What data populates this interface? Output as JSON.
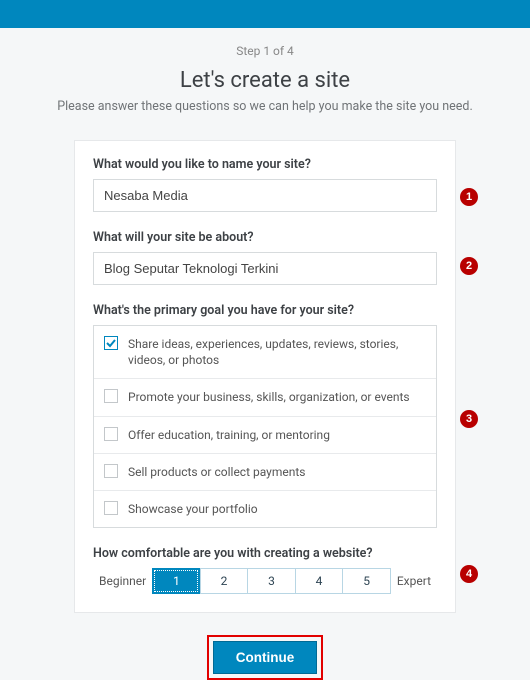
{
  "step": "Step 1 of 4",
  "heading": "Let's create a site",
  "subtitle": "Please answer these questions so we can help you make the site you need.",
  "form": {
    "name_label": "What would you like to name your site?",
    "name_value": "Nesaba Media",
    "about_label": "What will your site be about?",
    "about_value": "Blog Seputar Teknologi Terkini",
    "goal_label": "What's the primary goal you have for your site?",
    "goals": [
      {
        "text": "Share ideas, experiences, updates, reviews, stories, videos, or photos",
        "checked": true
      },
      {
        "text": "Promote your business, skills, organization, or events",
        "checked": false
      },
      {
        "text": "Offer education, training, or mentoring",
        "checked": false
      },
      {
        "text": "Sell products or collect payments",
        "checked": false
      },
      {
        "text": "Showcase your portfolio",
        "checked": false
      }
    ],
    "comfort_label": "How comfortable are you with creating a website?",
    "comfort_min_label": "Beginner",
    "comfort_max_label": "Expert",
    "comfort_options": [
      "1",
      "2",
      "3",
      "4",
      "5"
    ],
    "comfort_selected": "1",
    "continue_label": "Continue"
  },
  "annotations": [
    "1",
    "2",
    "3",
    "4"
  ]
}
